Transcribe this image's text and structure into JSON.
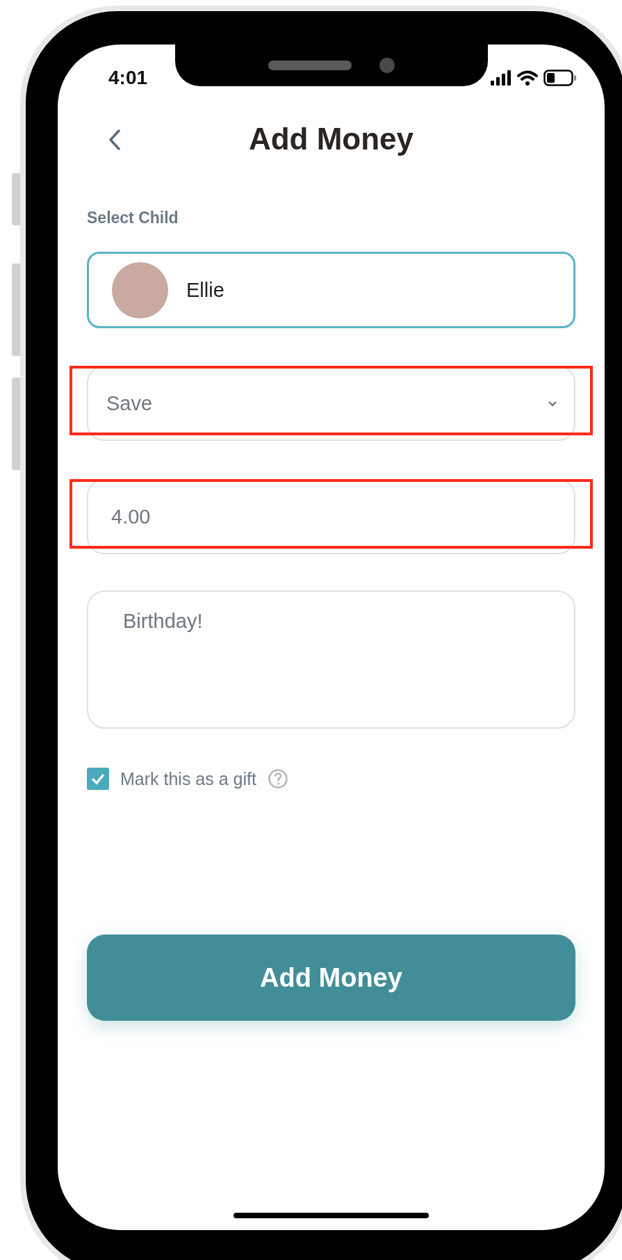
{
  "status_bar": {
    "time": "4:01"
  },
  "header": {
    "title": "Add Money"
  },
  "form": {
    "child_label": "Select Child",
    "child": {
      "name": "Ellie"
    },
    "category_select": {
      "value": "Save",
      "highlighted": true
    },
    "amount_field": {
      "value": "4.00",
      "highlighted": true
    },
    "note_field": {
      "value": "Birthday!"
    },
    "gift_checkbox": {
      "label": "Mark this as a gift",
      "checked": true
    }
  },
  "submit_button": {
    "label": "Add Money"
  }
}
